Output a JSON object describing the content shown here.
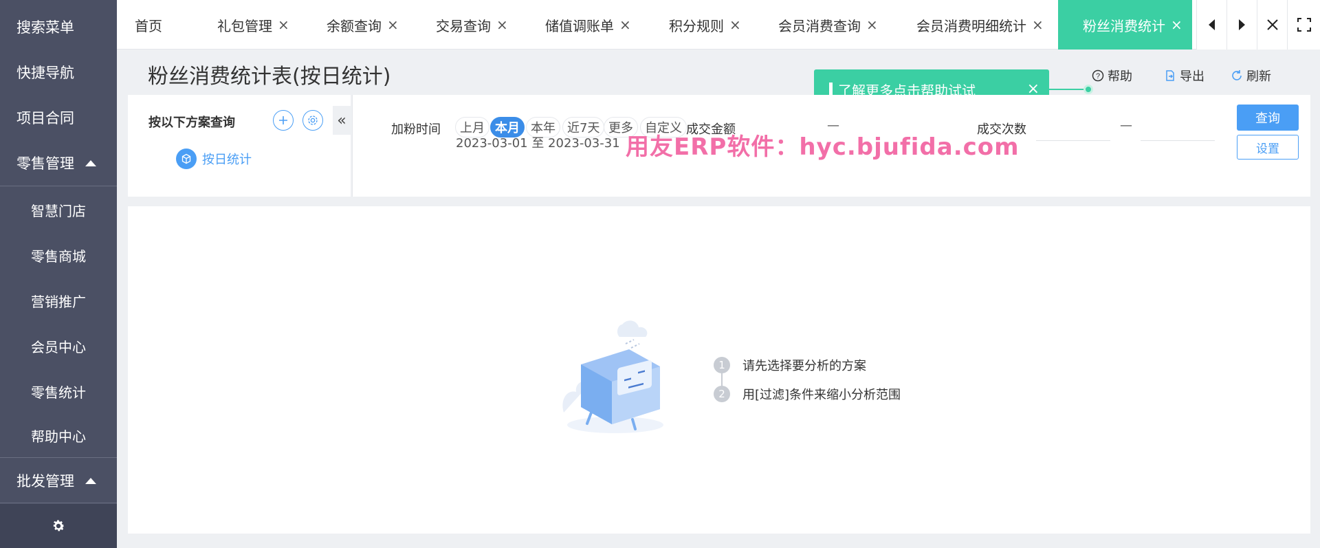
{
  "sidebar": {
    "items": [
      {
        "label": "搜索菜单"
      },
      {
        "label": "快捷导航"
      },
      {
        "label": "项目合同"
      },
      {
        "label": "零售管理"
      },
      {
        "label": "智慧门店"
      },
      {
        "label": "零售商城"
      },
      {
        "label": "营销推广"
      },
      {
        "label": "会员中心"
      },
      {
        "label": "零售统计"
      },
      {
        "label": "帮助中心"
      },
      {
        "label": "批发管理"
      }
    ]
  },
  "tabs": [
    {
      "label": "首页"
    },
    {
      "label": "礼包管理",
      "close": "×"
    },
    {
      "label": "余额查询",
      "close": "×"
    },
    {
      "label": "交易查询",
      "close": "×"
    },
    {
      "label": "储值调账单",
      "close": "×"
    },
    {
      "label": "积分规则",
      "close": "×"
    },
    {
      "label": "会员消费查询",
      "close": "×"
    },
    {
      "label": "会员消费明细统计",
      "close": "×"
    },
    {
      "label": "粉丝消费统计",
      "close": "×"
    }
  ],
  "header": {
    "title": "粉丝消费统计表(按日统计)",
    "tip": "了解更多点击帮助试试",
    "tip_close": "×",
    "help_label": "帮助",
    "export_label": "导出",
    "refresh_label": "刷新"
  },
  "scheme": {
    "title": "按以下方案查询",
    "collapse": "«",
    "item_label": "按日统计"
  },
  "filter": {
    "fans_time_label": "加粉时间",
    "chips": [
      "上月",
      "本月",
      "本年",
      "近7天",
      "更多",
      "自定义"
    ],
    "active_chip": "本月",
    "date_range": "2023-03-01 至 2023-03-31",
    "amount_label": "成交金额",
    "amount_dash": "—",
    "count_label": "成交次数",
    "count_dash": "—",
    "query_button": "查询",
    "setting_button": "设置"
  },
  "watermark": "用友ERP软件：hyc.bjufida.com",
  "empty_state": {
    "steps": [
      {
        "num": "1",
        "text": "请先选择要分析的方案"
      },
      {
        "num": "2",
        "text": "用[过滤]条件来缩小分析范围"
      }
    ]
  },
  "colors": {
    "sidebar_bg": "#4b5064",
    "accent_green": "#3bcfa3",
    "accent_blue": "#4a9ef5",
    "watermark": "#f26fa8"
  }
}
